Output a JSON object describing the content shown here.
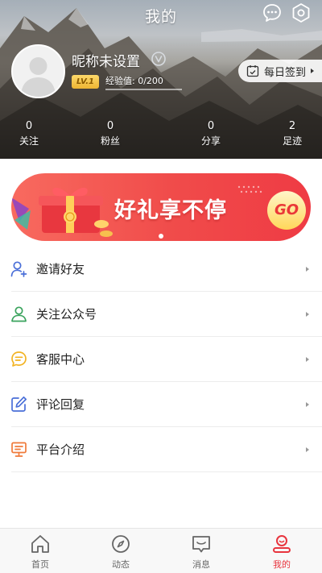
{
  "header": {
    "title": "我的",
    "message_icon": "chat-bubble-icon",
    "settings_icon": "hexagon-gear-icon"
  },
  "profile": {
    "nickname": "昵称未设置",
    "level": "LV.1",
    "experience_label": "经验值:",
    "experience_value": "0/200",
    "experience_progress": 0,
    "checkin_label": "每日签到"
  },
  "stats": [
    {
      "value": "0",
      "label": "关注"
    },
    {
      "value": "0",
      "label": "粉丝"
    },
    {
      "value": "0",
      "label": "分享"
    },
    {
      "value": "2",
      "label": "足迹"
    }
  ],
  "banner": {
    "text": "好礼享不停",
    "button": "GO"
  },
  "menu": [
    {
      "label": "邀请好友",
      "icon": "person-add-icon",
      "color": "#4a6fd8"
    },
    {
      "label": "关注公众号",
      "icon": "person-icon",
      "color": "#3aa35d"
    },
    {
      "label": "客服中心",
      "icon": "chat-lines-icon",
      "color": "#f2b323"
    },
    {
      "label": "评论回复",
      "icon": "edit-icon",
      "color": "#4a6fd8"
    },
    {
      "label": "平台介绍",
      "icon": "monitor-icon",
      "color": "#f07a3a"
    }
  ],
  "tabs": [
    {
      "label": "首页",
      "icon": "home-icon"
    },
    {
      "label": "动态",
      "icon": "compass-icon"
    },
    {
      "label": "消息",
      "icon": "message-icon"
    },
    {
      "label": "我的",
      "icon": "profile-icon",
      "active": true
    }
  ],
  "colors": {
    "accent": "#e8353e",
    "banner_red": "#f04b4a",
    "level_gold": "#f3c24a"
  }
}
